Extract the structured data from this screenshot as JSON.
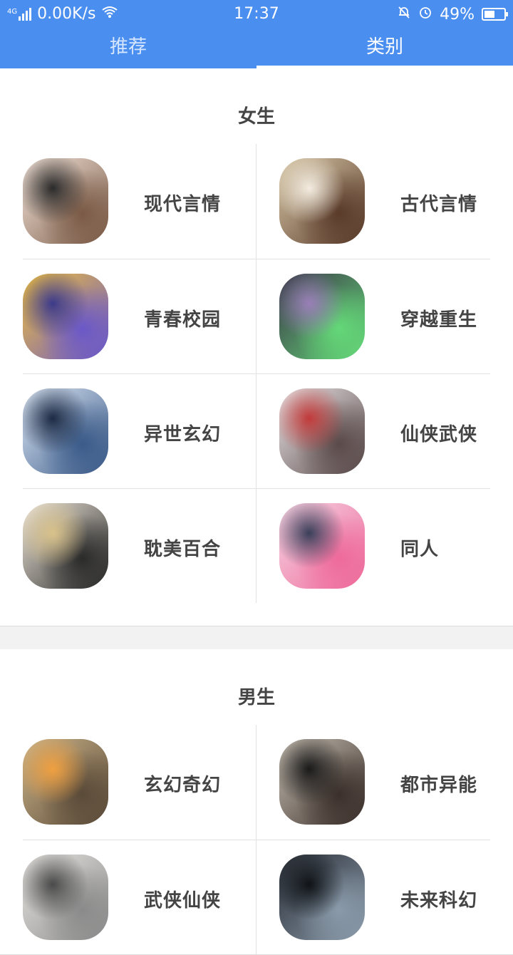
{
  "status_bar": {
    "network": "4G",
    "speed": "0.00K/s",
    "time": "17:37",
    "battery": "49%"
  },
  "tabs": [
    {
      "label": "推荐",
      "active": false
    },
    {
      "label": "类别",
      "active": true
    }
  ],
  "sections": [
    {
      "title": "女生",
      "items": [
        {
          "label": "现代言情",
          "colors": [
            "#f5e6dc",
            "#7a5a46",
            "#2b2b2b"
          ]
        },
        {
          "label": "古代言情",
          "colors": [
            "#d8c8a8",
            "#5a3b2a",
            "#f3ece0"
          ]
        },
        {
          "label": "青春校园",
          "colors": [
            "#f2c23a",
            "#6a58c8",
            "#3c3a8a"
          ]
        },
        {
          "label": "穿越重生",
          "colors": [
            "#3a3548",
            "#64d878",
            "#9a7fb8"
          ]
        },
        {
          "label": "异世玄幻",
          "colors": [
            "#dfe9f6",
            "#3a5a88",
            "#1c2a44"
          ]
        },
        {
          "label": "仙侠武侠",
          "colors": [
            "#ece6e8",
            "#5a4a4a",
            "#c23a3a"
          ]
        },
        {
          "label": "耽美百合",
          "colors": [
            "#f1e9dc",
            "#2a2a2a",
            "#d9c28a"
          ]
        },
        {
          "label": "同人",
          "colors": [
            "#f6d6e4",
            "#ee6a9a",
            "#3a3f5a"
          ]
        }
      ]
    },
    {
      "title": "男生",
      "items": [
        {
          "label": "玄幻奇幻",
          "colors": [
            "#cdb58a",
            "#5a4a38",
            "#f0a040"
          ]
        },
        {
          "label": "都市异能",
          "colors": [
            "#c8c0b4",
            "#3a2f2a",
            "#1a1a1a"
          ]
        },
        {
          "label": "武侠仙侠",
          "colors": [
            "#e8e6e2",
            "#8a8a8a",
            "#4a4a4a"
          ]
        },
        {
          "label": "未来科幻",
          "colors": [
            "#2a2e36",
            "#8a9aaa",
            "#101418"
          ]
        }
      ]
    }
  ]
}
